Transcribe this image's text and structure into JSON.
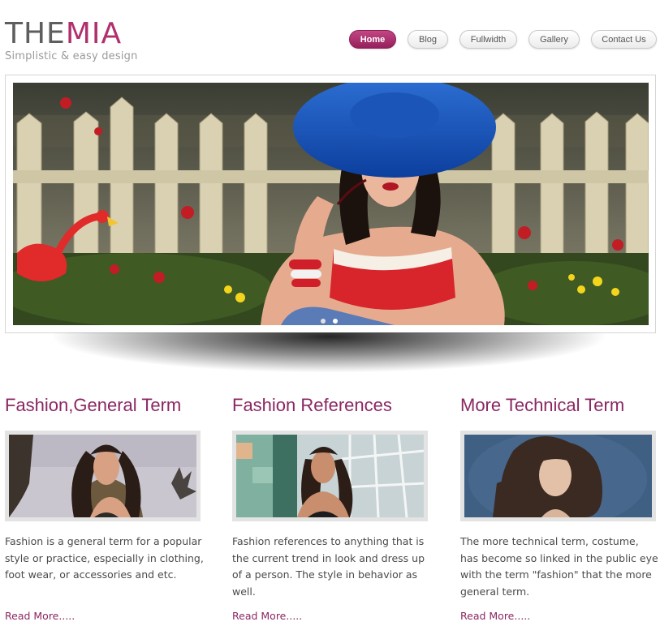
{
  "logo": {
    "part1": "THE",
    "part2": "MIA",
    "tagline": "Simplistic & easy design"
  },
  "nav": {
    "items": [
      {
        "label": "Home",
        "active": true
      },
      {
        "label": "Blog",
        "active": false
      },
      {
        "label": "Fullwidth",
        "active": false
      },
      {
        "label": "Gallery",
        "active": false
      },
      {
        "label": "Contact Us",
        "active": false
      }
    ]
  },
  "slider": {
    "slides": 2,
    "active": 1
  },
  "columns": [
    {
      "title": "Fashion,General Term",
      "text": "Fashion is a general term for a popular style or practice, especially in clothing, foot wear, or accessories and etc.",
      "link": "Read More....."
    },
    {
      "title": "Fashion References",
      "text": "Fashion references to anything that is the current trend in look and dress up of a person. The style in behavior as well.",
      "link": "Read More....."
    },
    {
      "title": "More Technical Term",
      "text": "The more technical term, costume, has become so linked in the public eye with the term \"fashion\" that the more general term.",
      "link": "Read More....."
    }
  ],
  "colors": {
    "accent": "#8b2763",
    "brand": "#b0306e",
    "logo_grey": "#5e5e5e"
  }
}
